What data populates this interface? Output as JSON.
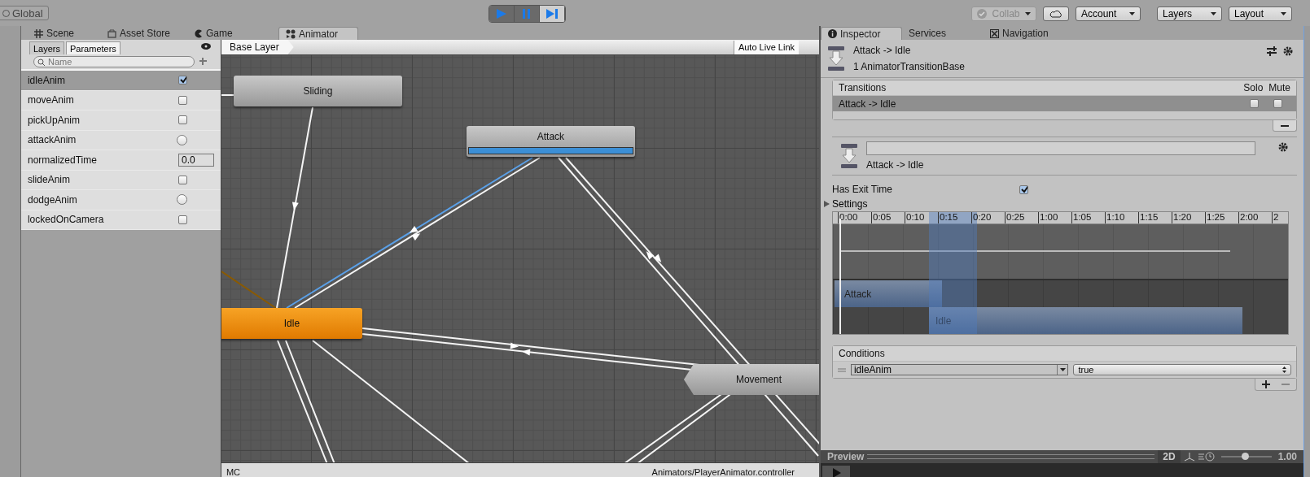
{
  "toolbar": {
    "global_button": "Global",
    "play_controls": [
      {
        "kind": "play",
        "selected": true
      },
      {
        "kind": "pause",
        "selected": true
      },
      {
        "kind": "step",
        "selected": false
      }
    ],
    "collab_button": "Collab",
    "account_menu": "Account",
    "layers_menu": "Layers",
    "layout_menu": "Layout"
  },
  "editor_tabs": [
    {
      "label": "Scene",
      "kind": "scene",
      "selected": false
    },
    {
      "label": "Asset Store",
      "kind": "store",
      "selected": false
    },
    {
      "label": "Game",
      "kind": "game",
      "selected": false
    },
    {
      "label": "Animator",
      "kind": "animator",
      "selected": true
    }
  ],
  "animator": {
    "panel_tabs": [
      {
        "label": "Layers",
        "selected": false
      },
      {
        "label": "Parameters",
        "selected": true
      }
    ],
    "search": {
      "placeholder": "Name"
    },
    "parameters": [
      {
        "name": "idleAnim",
        "kind": "bool",
        "checked": true,
        "selected": true
      },
      {
        "name": "moveAnim",
        "kind": "bool",
        "checked": false,
        "selected": false
      },
      {
        "name": "pickUpAnim",
        "kind": "bool",
        "checked": false,
        "selected": false
      },
      {
        "name": "attackAnim",
        "kind": "trigger",
        "checked": false,
        "selected": false
      },
      {
        "name": "normalizedTime",
        "kind": "float",
        "value": "0.0",
        "selected": false
      },
      {
        "name": "slideAnim",
        "kind": "bool",
        "checked": false,
        "selected": false
      },
      {
        "name": "dodgeAnim",
        "kind": "trigger",
        "checked": false,
        "selected": false
      },
      {
        "name": "lockedOnCamera",
        "kind": "bool",
        "checked": false,
        "selected": false
      }
    ],
    "breadcrumb": "Base Layer",
    "live_link_button": "Auto Live Link",
    "states": [
      {
        "name": "Sliding",
        "kind": "normal"
      },
      {
        "name": "Attack",
        "kind": "playing",
        "level": 1
      },
      {
        "name": "Idle",
        "kind": "default"
      },
      {
        "name": "Movement",
        "kind": "pointed"
      }
    ],
    "status_bar": {
      "left": "MC",
      "right": "Animators/PlayerAnimator.controller"
    }
  },
  "inspector": {
    "tabs": [
      {
        "label": "Inspector",
        "kind": "info",
        "selected": true
      },
      {
        "label": "Services",
        "kind": "none",
        "selected": false
      },
      {
        "label": "Navigation",
        "kind": "nav",
        "selected": false
      }
    ],
    "title": "Attack -> Idle",
    "subtitle": "1 AnimatorTransitionBase",
    "transitions": {
      "header": "Transitions",
      "solo_label": "Solo",
      "mute_label": "Mute",
      "rows": [
        {
          "name": "Attack -> Idle",
          "selected": true,
          "solo": false,
          "mute": false
        }
      ]
    },
    "transition_caption": "Attack -> Idle",
    "has_exit_time": {
      "label": "Has Exit Time",
      "checked": true
    },
    "settings": {
      "label": "Settings",
      "expanded": false
    },
    "timeline": {
      "ticks": [
        "0:00",
        "0:05",
        "0:10",
        "0:15",
        "0:20",
        "0:25",
        "1:00",
        "1:05",
        "1:10",
        "1:15",
        "1:20",
        "1:25",
        "2:00",
        "2"
      ],
      "clips": [
        {
          "name": "Attack"
        },
        {
          "name": "Idle"
        }
      ]
    },
    "conditions": {
      "header": "Conditions",
      "rows": [
        {
          "parameter": "idleAnim",
          "value": "true"
        }
      ]
    },
    "preview": {
      "label": "Preview",
      "mode": "2D",
      "speed": "1.00",
      "level": 0.47
    }
  }
}
